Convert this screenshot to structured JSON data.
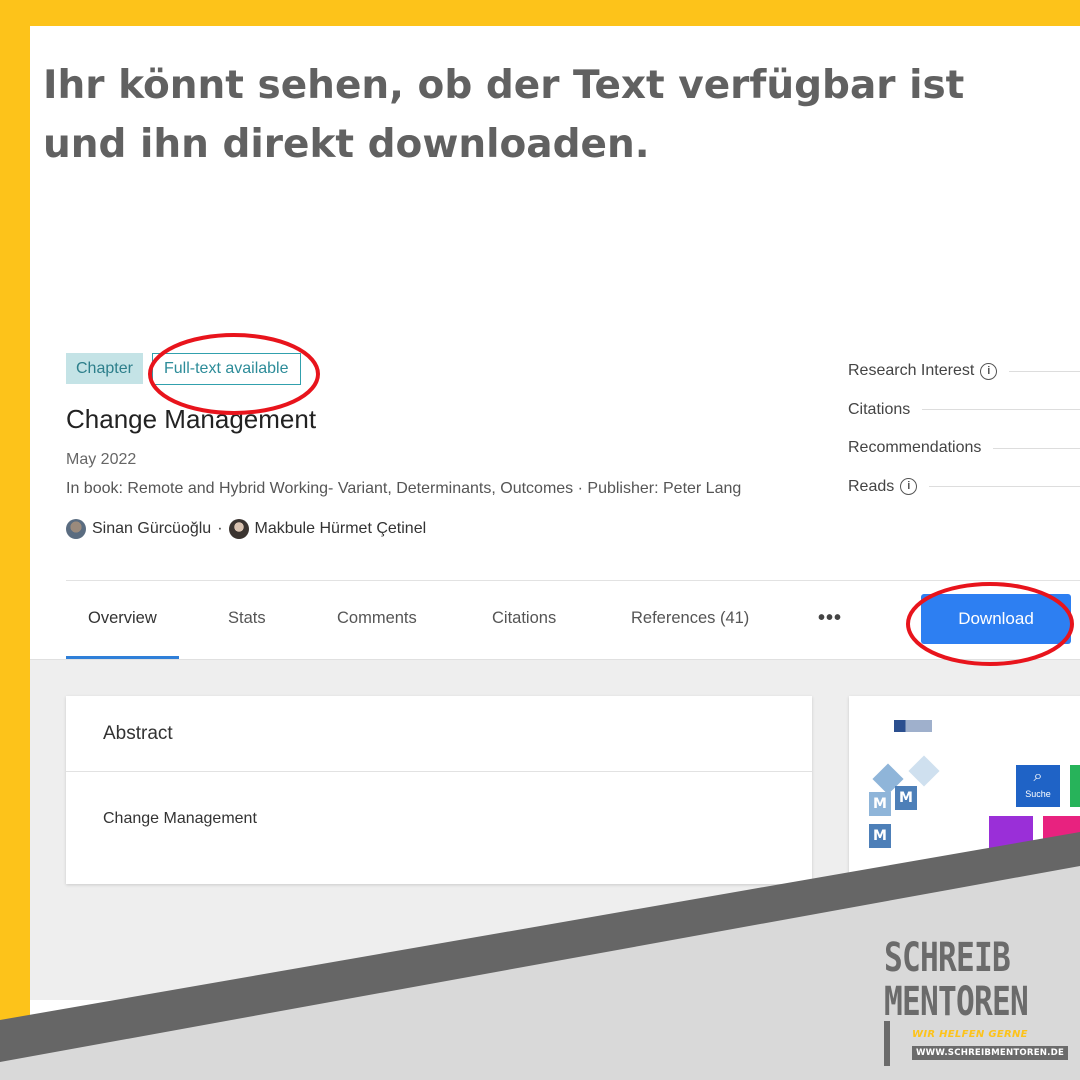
{
  "headline": "Ihr könnt sehen, ob der Text verfügbar ist und ihn direkt downloaden.",
  "publication": {
    "tags": {
      "type": "Chapter",
      "availability": "Full-text available"
    },
    "title": "Change Management",
    "date": "May 2022",
    "book": "In book: Remote and Hybrid Working- Variant, Determinants, Outcomes · Publisher: Peter Lang",
    "authors": [
      {
        "name": "Sinan Gürcüoğlu"
      },
      {
        "name": "Makbule Hürmet Çetinel"
      }
    ],
    "author_separator": "·"
  },
  "stats": [
    {
      "label": "Research Interest",
      "info_icon": "info-icon"
    },
    {
      "label": "Citations"
    },
    {
      "label": "Recommendations"
    },
    {
      "label": "Reads",
      "info_icon": "info-icon"
    }
  ],
  "tabs": [
    {
      "label": "Overview",
      "active": true
    },
    {
      "label": "Stats"
    },
    {
      "label": "Comments"
    },
    {
      "label": "Citations"
    },
    {
      "label": "References (41)"
    }
  ],
  "more_icon": "more-dots-icon",
  "more_glyph": "•••",
  "download_label": "Download",
  "abstract": {
    "heading": "Abstract",
    "body": "Change Management"
  },
  "preview": {
    "tile_label": "Suche"
  },
  "brand": {
    "line1": "SCHREIB",
    "line2": "MENTOREN",
    "tagline": "WIR HELFEN GERNE",
    "url": "WWW.SCHREIBMENTOREN.DE"
  },
  "colors": {
    "frame_yellow": "#fdc31a",
    "headline_gray": "#616161",
    "download_blue": "#2d7ff2",
    "highlight_red": "#e8141c",
    "tag_teal": "#31a0ad"
  }
}
